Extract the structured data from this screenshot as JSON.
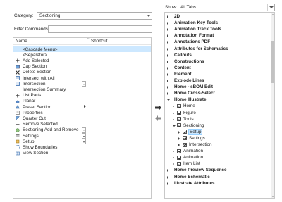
{
  "left": {
    "category_label": "Category:",
    "category_value": "Sectioning",
    "filter_label": "Filter Commands:",
    "filter_value": "",
    "columns": {
      "name": "Name",
      "sort_indicator": "^",
      "shortcut": "Shortcut"
    },
    "commands": [
      {
        "label": "<Cascade Menu>",
        "icon": "none",
        "selected": true
      },
      {
        "label": "<Separator>",
        "icon": "none"
      },
      {
        "label": "Add Selected",
        "icon": "plus-icon"
      },
      {
        "label": "Cap Section",
        "icon": "cap-section-icon"
      },
      {
        "label": "Delete Section",
        "icon": "x-icon"
      },
      {
        "label": "Intersect with All",
        "icon": "intersect-icon"
      },
      {
        "label": "Intersection",
        "icon": "intersection-icon",
        "control": "dropdown"
      },
      {
        "label": "Intersection Summary",
        "icon": "none"
      },
      {
        "label": "List Parts",
        "icon": "plus-icon"
      },
      {
        "label": "Planar",
        "icon": "planar-icon"
      },
      {
        "label": "Preset Section",
        "icon": "preset-icon",
        "control": "submenu"
      },
      {
        "label": "Properties",
        "icon": "properties-icon"
      },
      {
        "label": "Quarter Cut",
        "icon": "quarter-cut-icon"
      },
      {
        "label": "Remove Selected",
        "icon": "minus-icon"
      },
      {
        "label": "Sectioning Add and Remove",
        "icon": "section-add-remove-icon",
        "control": "dropdown"
      },
      {
        "label": "Settings",
        "icon": "settings-icon",
        "control": "dropdown"
      },
      {
        "label": "Setup",
        "icon": "setup-icon",
        "control": "dropdown"
      },
      {
        "label": "Show Boundaries",
        "icon": "show-boundaries-icon"
      },
      {
        "label": "View Section",
        "icon": "view-section-icon"
      }
    ]
  },
  "right": {
    "show_label": "Show:",
    "show_value": "All Tabs",
    "tree": [
      {
        "label": "2D",
        "depth": 0,
        "exp": "closed",
        "bold": true
      },
      {
        "label": "Animation Key Tools",
        "depth": 0,
        "exp": "closed",
        "bold": true
      },
      {
        "label": "Animation Track Tools",
        "depth": 0,
        "exp": "closed",
        "bold": true
      },
      {
        "label": "Annotation Format",
        "depth": 0,
        "exp": "closed",
        "bold": true
      },
      {
        "label": "Annotations PDF",
        "depth": 0,
        "exp": "closed",
        "bold": true
      },
      {
        "label": "Attributes for Schematics",
        "depth": 0,
        "exp": "closed",
        "bold": true
      },
      {
        "label": "Callouts",
        "depth": 0,
        "exp": "closed",
        "bold": true
      },
      {
        "label": "Constructions",
        "depth": 0,
        "exp": "closed",
        "bold": true
      },
      {
        "label": "Content",
        "depth": 0,
        "exp": "closed",
        "bold": true
      },
      {
        "label": "Element",
        "depth": 0,
        "exp": "closed",
        "bold": true
      },
      {
        "label": "Explode Lines",
        "depth": 0,
        "exp": "closed",
        "bold": true
      },
      {
        "label": "Home - sBOM Edit",
        "depth": 0,
        "exp": "closed",
        "bold": true
      },
      {
        "label": "Home Cross-Select",
        "depth": 0,
        "exp": "closed",
        "bold": true
      },
      {
        "label": "Home Illustrate",
        "depth": 0,
        "exp": "open",
        "bold": true
      },
      {
        "label": "Home",
        "depth": 1,
        "exp": "closed",
        "check": true
      },
      {
        "label": "Figure",
        "depth": 1,
        "exp": "closed",
        "check": true
      },
      {
        "label": "Tools",
        "depth": 1,
        "exp": "closed",
        "check": true
      },
      {
        "label": "Sectioning",
        "depth": 1,
        "exp": "open",
        "check": true
      },
      {
        "label": "Setup",
        "depth": 2,
        "exp": "closed",
        "check": true,
        "highlight": true
      },
      {
        "label": "Settings",
        "depth": 2,
        "exp": "closed",
        "check": true
      },
      {
        "label": "Intersection",
        "depth": 2,
        "exp": "closed",
        "check": true
      },
      {
        "label": "Animation",
        "depth": 1,
        "exp": "closed",
        "check": true
      },
      {
        "label": "Animation",
        "depth": 1,
        "exp": "closed",
        "check": true
      },
      {
        "label": "Item List",
        "depth": 1,
        "exp": "closed",
        "check": true
      },
      {
        "label": "Home Preview Sequence",
        "depth": 0,
        "exp": "closed",
        "bold": true
      },
      {
        "label": "Home Schematic",
        "depth": 0,
        "exp": "closed",
        "bold": true
      },
      {
        "label": "Illustrate Attributes",
        "depth": 0,
        "exp": "closed",
        "bold": true
      }
    ]
  },
  "colors": {
    "selection": "#cde8ff",
    "selection_border": "#99d1ff",
    "border": "#adadad",
    "arrow": "#555555"
  },
  "icons": {
    "add_arrow": "right-arrow-icon",
    "remove_arrow": "left-arrow-icon"
  }
}
